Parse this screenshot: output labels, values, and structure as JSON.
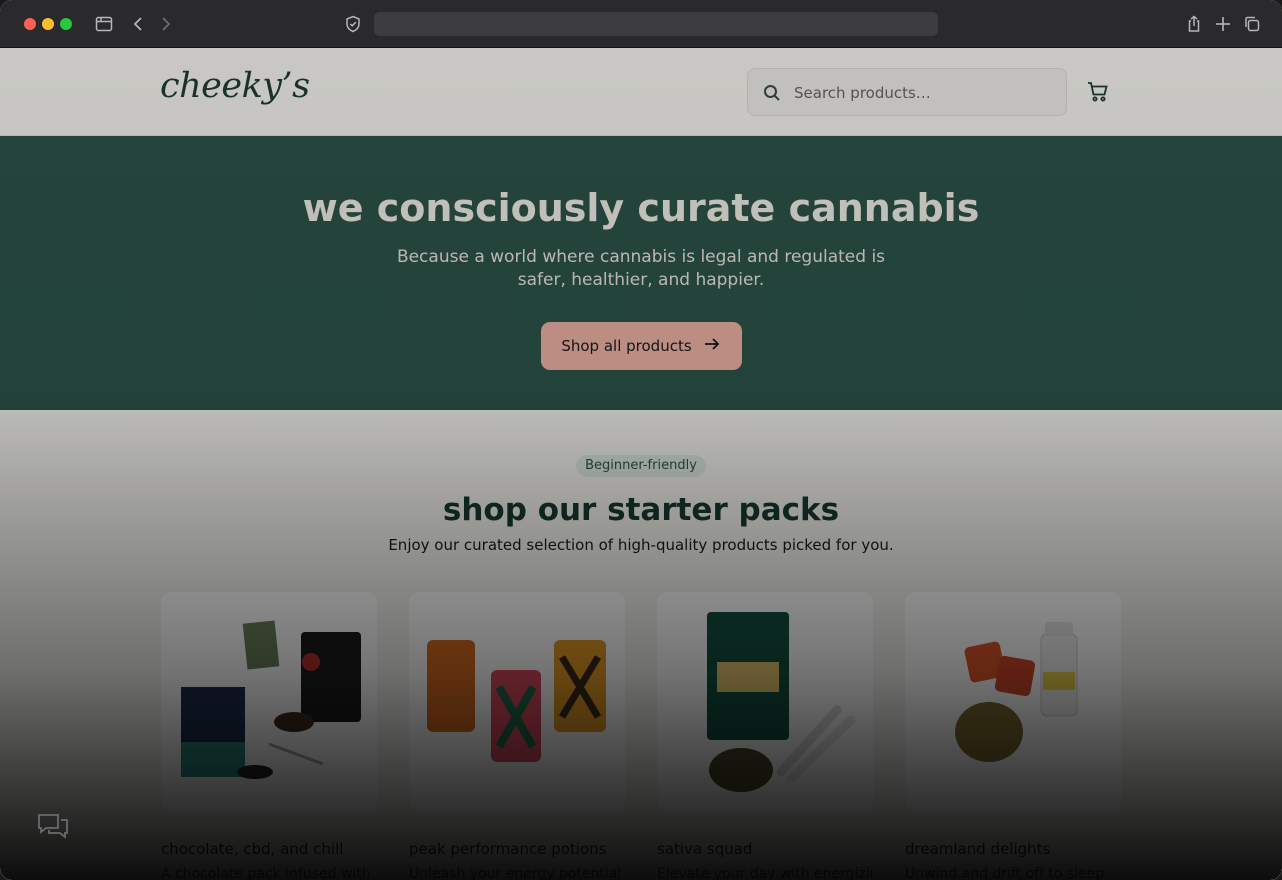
{
  "browser": {
    "url": ""
  },
  "site": {
    "logo": "cheeky’s",
    "search": {
      "placeholder": "Search products…"
    }
  },
  "hero": {
    "title": "we consciously curate cannabis",
    "subtitle_line1": "Because a world where cannabis is legal and regulated is",
    "subtitle_line2": "safer, healthier, and happier.",
    "button_label": "Shop all products"
  },
  "starter": {
    "eyebrow": "Beginner-friendly",
    "title": "shop our starter packs",
    "subtitle": "Enjoy our curated selection of high-quality products picked for you.",
    "cards": [
      {
        "title": "chocolate, cbd, and chill",
        "desc": "A chocolate pack infused with"
      },
      {
        "title": "peak performance potions",
        "desc": "Unleash your energy potential"
      },
      {
        "title": "sativa squad",
        "desc": "Elevate your day with energizing"
      },
      {
        "title": "dreamland delights",
        "desc": "Unwind and drift off to sleep"
      }
    ]
  },
  "colors": {
    "brand_green": "#2c5449",
    "accent_pink": "#eab0a2",
    "background": "#f4f3ee"
  },
  "icons": {
    "search": "search-icon",
    "cart": "cart-icon",
    "arrow": "arrow-right-icon",
    "chat": "chat-icon"
  }
}
